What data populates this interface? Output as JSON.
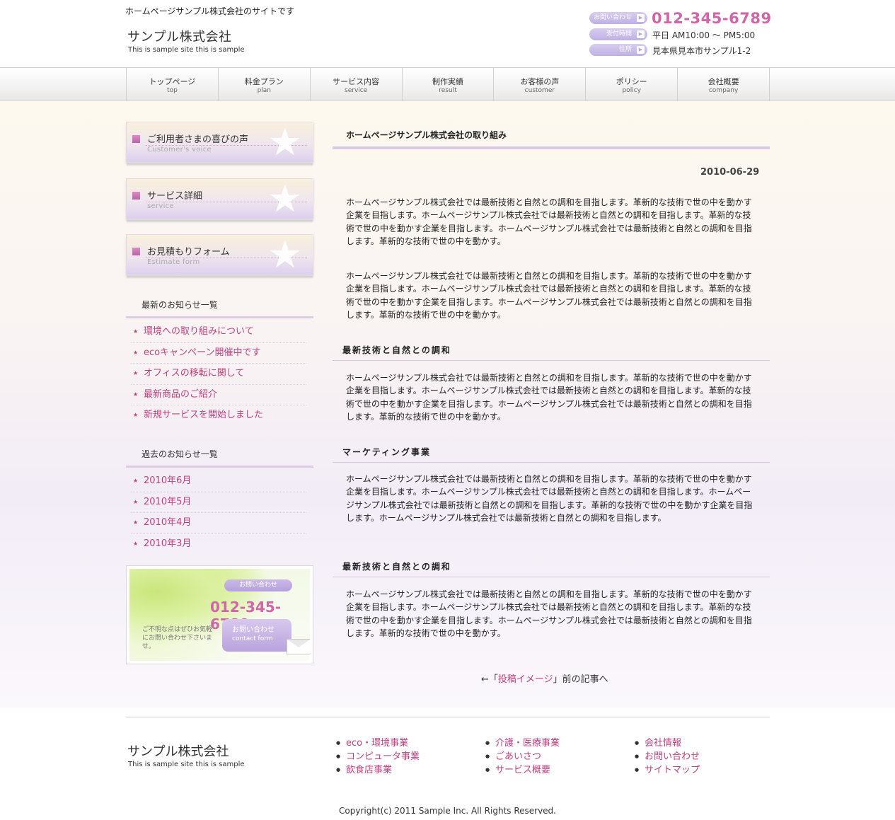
{
  "header": {
    "tagline": "ホームページサンプル株式会社のサイトです",
    "logo_name": "サンプル株式会社",
    "logo_sub": "This is sample site this is sample",
    "contact_label": "お問い合わせ",
    "phone": "012-345-6789",
    "hours_label": "受付時間",
    "hours": "平日 AM10:00 ～ PM5:00",
    "address_label": "住所",
    "address": "見本県見本市サンプル1-2"
  },
  "nav": [
    {
      "ja": "トップページ",
      "en": "top"
    },
    {
      "ja": "料金プラン",
      "en": "plan"
    },
    {
      "ja": "サービス内容",
      "en": "service"
    },
    {
      "ja": "制作実績",
      "en": "result"
    },
    {
      "ja": "お客様の声",
      "en": "customer"
    },
    {
      "ja": "ポリシー",
      "en": "policy"
    },
    {
      "ja": "会社概要",
      "en": "company"
    }
  ],
  "sidebar": {
    "banners": [
      {
        "title": "ご利用者さまの喜びの声",
        "sub": "Customer's voice"
      },
      {
        "title": "サービス詳細",
        "sub": "service"
      },
      {
        "title": "お見積もりフォーム",
        "sub": "Estimate form"
      }
    ],
    "latest_heading": "最新のお知らせ一覧",
    "latest": [
      "環境への取り組みについて",
      "ecoキャンペーン開催中です",
      "オフィスの移転に関して",
      "最新商品のご紹介",
      "新規サービスを開始しました"
    ],
    "past_heading": "過去のお知らせ一覧",
    "past": [
      "2010年6月",
      "2010年5月",
      "2010年4月",
      "2010年3月"
    ],
    "contact": {
      "label": "お問い合わせ",
      "phone": "012-345-6789",
      "note": "ご不明な点はぜひお気軽にお問い合わせ下さいませ。",
      "btn_ja": "お問い合わせ",
      "btn_en": "contact form"
    }
  },
  "main": {
    "title": "ホームページサンプル株式会社の取り組み",
    "date": "2010-06-29",
    "para1": "ホームページサンプル株式会社では最新技術と自然との調和を目指します。革新的な技術で世の中を動かす企業を目指します。ホームページサンプル株式会社では最新技術と自然との調和を目指します。革新的な技術で世の中を動かす企業を目指します。ホームページサンプル株式会社では最新技術と自然との調和を目指します。革新的な技術で世の中を動かす。",
    "para2": "ホームページサンプル株式会社では最新技術と自然との調和を目指します。革新的な技術で世の中を動かす企業を目指します。ホームページサンプル株式会社では最新技術と自然との調和を目指します。革新的な技術で世の中を動かす企業を目指します。ホームページサンプル株式会社では最新技術と自然との調和を目指します。革新的な技術で世の中を動かす。",
    "heading1": "最新技術と自然との調和",
    "para3": "ホームページサンプル株式会社では最新技術と自然との調和を目指します。革新的な技術で世の中を動かす企業を目指します。ホームページサンプル株式会社では最新技術と自然との調和を目指します。革新的な技術で世の中を動かす企業を目指します。ホームページサンプル株式会社では最新技術と自然との調和を目指します。革新的な技術で世の中を動かす。",
    "heading2": "マーケティング事業",
    "para4": "ホームページサンプル株式会社では最新技術と自然との調和を目指します。革新的な技術で世の中を動かす企業を目指します。ホームページサンプル株式会社では最新技術と自然との調和を目指します。ホームページサンプル株式会社では最新技術と自然との調和を目指します。革新的な技術で世の中を動かす企業を目指します。ホームページサンプル株式会社では最新技術と自然との調和を目指します。",
    "heading3": "最新技術と自然との調和",
    "para5": "ホームページサンプル株式会社では最新技術と自然との調和を目指します。革新的な技術で世の中を動かす企業を目指します。ホームページサンプル株式会社では最新技術と自然との調和を目指します。革新的な技術で世の中を動かす企業を目指します。ホームページサンプル株式会社では最新技術と自然との調和を目指します。革新的な技術で世の中を動かす。",
    "prev_prefix": "←「",
    "prev_link": "投稿イメージ",
    "prev_suffix": "」前の記事へ"
  },
  "footer": {
    "logo_name": "サンプル株式会社",
    "logo_sub": "This is sample site this is sample",
    "col1": [
      "eco・環境事業",
      "コンピュータ事業",
      "飲食店事業"
    ],
    "col2": [
      "介護・医療事業",
      "ごあいさつ",
      "サービス概要"
    ],
    "col3": [
      "会社情報",
      "お問い合わせ",
      "サイトマップ"
    ],
    "copyright": "Copyright(c) 2011 Sample Inc. All Rights Reserved."
  }
}
